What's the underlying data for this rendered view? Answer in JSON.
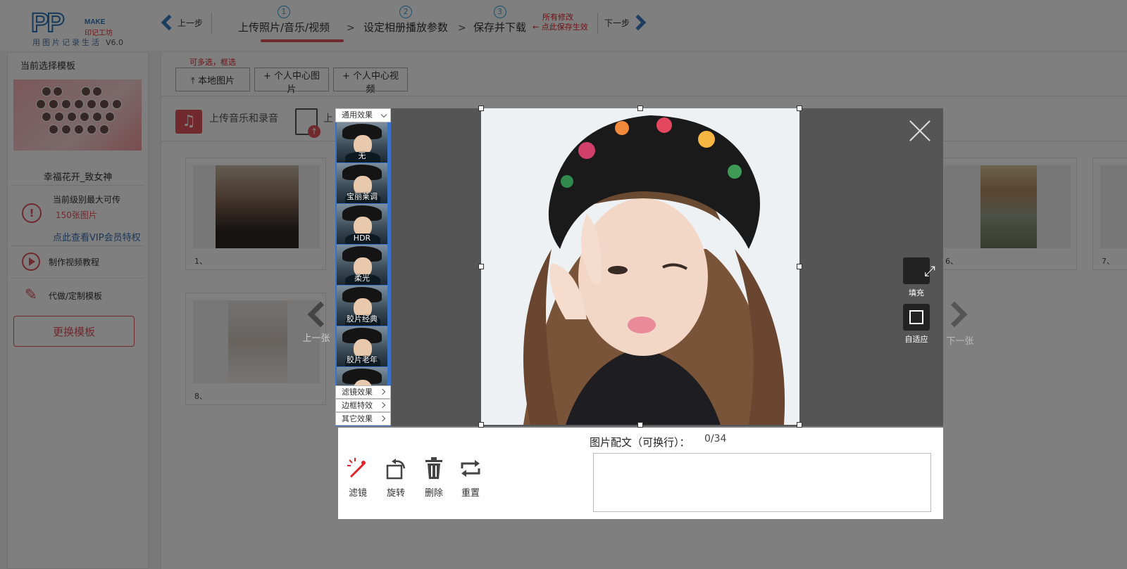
{
  "header": {
    "logo_pp": "PP",
    "logo_make": "MAKE",
    "logo_cn": "印记工坊",
    "slogan": "用图片记录生活",
    "version": "V6.0",
    "prev_label": "上一步",
    "next_label": "下一步",
    "steps": [
      {
        "num": "1",
        "label": "上传照片/音乐/视频"
      },
      {
        "num": "2",
        "label": "设定相册播放参数"
      },
      {
        "num": "3",
        "label": "保存并下载"
      }
    ],
    "step_sep": ">",
    "save_note_line1": "所有修改",
    "save_note_line2": "点此保存生效"
  },
  "sidebar": {
    "title": "当前选择模板",
    "template_name": "幸福花开_致女神",
    "level_text": "当前级别最大可传",
    "level_count": "150张图片",
    "vip_link": "点此查看VIP会员特权",
    "items": [
      {
        "label": "制作视频教程"
      },
      {
        "label": "代做/定制模板"
      }
    ],
    "swap_button": "更换模板"
  },
  "main": {
    "hint": "可多选，框选",
    "buttons": {
      "local": "本地图片",
      "center_photo": "+ 个人中心图片",
      "center_video": "+ 个人中心视频"
    },
    "music_label": "上传音乐和录音",
    "doc_label": "上",
    "cards": [
      {
        "caption": "1、"
      },
      {
        "caption": "6、"
      },
      {
        "caption": "7、"
      },
      {
        "caption": "8、"
      }
    ]
  },
  "modal": {
    "effects_dropdown": "通用效果",
    "effects": [
      {
        "label": "无"
      },
      {
        "label": "宝丽莱调"
      },
      {
        "label": "HDR"
      },
      {
        "label": "柔光"
      },
      {
        "label": "胶片经典"
      },
      {
        "label": "胶片老年"
      },
      {
        "label": ""
      }
    ],
    "menus": [
      {
        "label": "滤镜效果"
      },
      {
        "label": "边框特效"
      },
      {
        "label": "其它效果"
      }
    ],
    "fill_label": "填充",
    "fit_label": "自适应",
    "prev_photo": "上一张",
    "next_photo": "下一张",
    "tools": [
      {
        "label": "滤镜"
      },
      {
        "label": "旋转"
      },
      {
        "label": "删除"
      },
      {
        "label": "重置"
      }
    ],
    "caption_label": "图片配文（可换行）：",
    "caption_count": "0/34",
    "caption_value": ""
  },
  "colors": {
    "accent_red": "#e0545a",
    "brand_blue": "#3a7cc4",
    "effects_blue": "#3a72c9"
  }
}
